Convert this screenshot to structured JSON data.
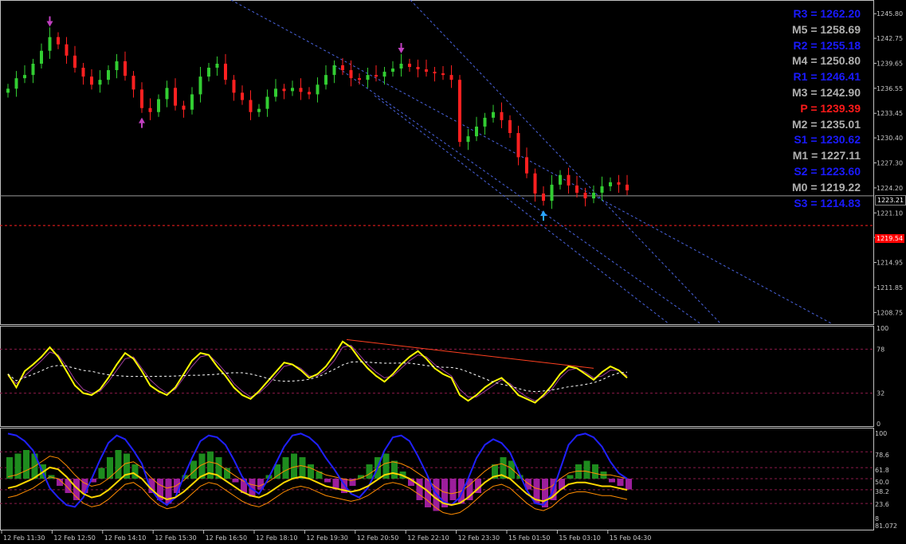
{
  "price_axis": {
    "labels": [
      "1245.80",
      "1242.75",
      "1239.65",
      "1236.55",
      "1233.45",
      "1230.40",
      "1227.30",
      "1224.20",
      "1221.10",
      "1218.05",
      "1214.95",
      "1211.85",
      "1208.75"
    ],
    "current_price": "1223.21",
    "alert_price": "1219.54"
  },
  "stoch_axis": {
    "labels": [
      "100",
      "78",
      "32",
      "0"
    ]
  },
  "osc_axis": {
    "labels": [
      "100",
      "78.6",
      "61.8",
      "50.0",
      "38.2",
      "23.6",
      "8",
      "81.072"
    ]
  },
  "time_axis": {
    "labels": [
      "12 Feb 11:30",
      "12 Feb 12:50",
      "12 Feb 14:10",
      "12 Feb 15:30",
      "12 Feb 16:50",
      "12 Feb 18:10",
      "12 Feb 19:30",
      "12 Feb 20:50",
      "12 Feb 22:10",
      "12 Feb 23:30",
      "15 Feb 01:50",
      "15 Feb 03:10",
      "15 Feb 04:30"
    ]
  },
  "pivots": [
    {
      "label": "R3 = 1262.20",
      "color": "#1a1aff"
    },
    {
      "label": "M5 = 1258.69",
      "color": "#b0b0b0"
    },
    {
      "label": "R2 = 1255.18",
      "color": "#1a1aff"
    },
    {
      "label": "M4 = 1250.80",
      "color": "#b0b0b0"
    },
    {
      "label": "R1 = 1246.41",
      "color": "#1a1aff"
    },
    {
      "label": "M3 = 1242.90",
      "color": "#b0b0b0"
    },
    {
      "label": "P  = 1239.39",
      "color": "#ff1a1a"
    },
    {
      "label": "M2 = 1235.01",
      "color": "#b0b0b0"
    },
    {
      "label": "S1 = 1230.62",
      "color": "#1a1aff"
    },
    {
      "label": "M1 = 1227.11",
      "color": "#b0b0b0"
    },
    {
      "label": "S2 = 1223.60",
      "color": "#1a1aff"
    },
    {
      "label": "M0 = 1219.22",
      "color": "#b0b0b0"
    },
    {
      "label": "S3 = 1214.83",
      "color": "#1a1aff"
    }
  ],
  "colors": {
    "bull": "#32cd32",
    "bear": "#ff2020",
    "channel": "#4a64e0",
    "stoch_main": "#ffff00",
    "stoch_signal": "#9a3a9a",
    "stoch_ma": "#ffffff",
    "osc_blue": "#2020ff",
    "osc_yellow": "#ffd700",
    "osc_orange": "#ff8c00",
    "hist_pos": "#1e8c1e",
    "hist_neg": "#9c1e9c",
    "level_dash": "#8c1a4a"
  },
  "chart_data": {
    "type": "candlestick",
    "ylim": [
      1207.4,
      1247.3
    ],
    "close_path": [
      1236.5,
      1237.8,
      1238.2,
      1239.6,
      1241.2,
      1242.9,
      1242.0,
      1240.6,
      1239.1,
      1238.0,
      1237.0,
      1237.6,
      1238.8,
      1239.9,
      1238.1,
      1236.4,
      1234.1,
      1233.6,
      1235.2,
      1236.6,
      1234.4,
      1233.9,
      1235.8,
      1238.0,
      1239.1,
      1239.6,
      1237.6,
      1236.0,
      1235.1,
      1233.6,
      1234.0,
      1235.5,
      1236.5,
      1236.2,
      1236.6,
      1236.1,
      1235.8,
      1237.0,
      1238.2,
      1239.4,
      1238.8,
      1237.8,
      1237.6,
      1238.2,
      1238.0,
      1238.6,
      1239.0,
      1239.6,
      1239.2,
      1238.9,
      1238.6,
      1238.4,
      1238.2,
      1237.6,
      1229.9,
      1230.6,
      1231.8,
      1232.9,
      1233.6,
      1232.6,
      1231.0,
      1228.0,
      1226.0,
      1223.5,
      1222.6,
      1224.6,
      1225.8,
      1224.5,
      1223.6,
      1222.9,
      1223.6,
      1224.4,
      1224.9,
      1224.6,
      1223.9
    ],
    "markers": [
      {
        "type": "down-arrow",
        "at_index": 5
      },
      {
        "type": "up-arrow",
        "at_index": 16
      },
      {
        "type": "down-arrow",
        "at_index": 47
      },
      {
        "type": "up-arrow",
        "at_index": 64
      }
    ],
    "stochastic": {
      "levels": [
        78,
        32
      ],
      "main": [
        52,
        38,
        55,
        62,
        70,
        80,
        70,
        55,
        40,
        32,
        30,
        36,
        48,
        62,
        74,
        68,
        55,
        40,
        34,
        30,
        38,
        52,
        66,
        74,
        72,
        60,
        50,
        38,
        30,
        26,
        34,
        44,
        54,
        64,
        62,
        56,
        48,
        52,
        60,
        72,
        86,
        80,
        68,
        58,
        50,
        44,
        52,
        62,
        70,
        76,
        68,
        58,
        52,
        48,
        30,
        24,
        30,
        38,
        44,
        48,
        40,
        30,
        26,
        22,
        30,
        40,
        52,
        60,
        58,
        52,
        46,
        54,
        60,
        56,
        48
      ],
      "signal": [
        50,
        42,
        50,
        58,
        66,
        75,
        72,
        60,
        46,
        36,
        32,
        34,
        44,
        56,
        68,
        70,
        58,
        46,
        38,
        32,
        36,
        48,
        60,
        70,
        72,
        64,
        54,
        42,
        34,
        28,
        32,
        40,
        50,
        60,
        62,
        58,
        50,
        50,
        56,
        66,
        80,
        82,
        72,
        62,
        54,
        48,
        50,
        58,
        66,
        72,
        70,
        62,
        56,
        50,
        36,
        28,
        28,
        34,
        40,
        46,
        42,
        34,
        28,
        24,
        28,
        36,
        48,
        56,
        58,
        54,
        48,
        50,
        56,
        56,
        50
      ]
    },
    "oscillator": {
      "levels": [
        78.6,
        61.8,
        50.0,
        38.2,
        23.6
      ],
      "blue": [
        98,
        96,
        90,
        80,
        60,
        40,
        30,
        22,
        20,
        30,
        50,
        70,
        88,
        96,
        92,
        80,
        66,
        40,
        28,
        22,
        30,
        52,
        72,
        90,
        96,
        94,
        86,
        70,
        52,
        40,
        34,
        48,
        66,
        84,
        96,
        98,
        94,
        86,
        72,
        60,
        46,
        34,
        30,
        40,
        58,
        80,
        94,
        96,
        90,
        74,
        56,
        36,
        26,
        22,
        30,
        50,
        72,
        86,
        92,
        88,
        78,
        58,
        38,
        24,
        22,
        34,
        60,
        86,
        96,
        98,
        94,
        84,
        68,
        56,
        50
      ],
      "yellow": [
        40,
        42,
        46,
        50,
        56,
        62,
        60,
        52,
        42,
        34,
        30,
        32,
        38,
        46,
        54,
        56,
        50,
        40,
        32,
        28,
        30,
        36,
        44,
        52,
        56,
        54,
        48,
        42,
        36,
        32,
        30,
        34,
        40,
        46,
        50,
        52,
        50,
        46,
        42,
        40,
        38,
        36,
        38,
        42,
        48,
        54,
        56,
        54,
        50,
        44,
        38,
        30,
        24,
        22,
        24,
        30,
        38,
        46,
        52,
        54,
        50,
        42,
        34,
        28,
        26,
        30,
        38,
        44,
        46,
        46,
        44,
        42,
        42,
        40,
        38
      ],
      "hist": [
        60,
        70,
        80,
        70,
        40,
        10,
        -20,
        -40,
        -60,
        -40,
        -10,
        30,
        60,
        80,
        70,
        40,
        0,
        -40,
        -60,
        -70,
        -40,
        10,
        50,
        70,
        76,
        60,
        30,
        -10,
        -40,
        -50,
        -30,
        10,
        40,
        60,
        70,
        60,
        40,
        20,
        -10,
        -30,
        -40,
        -20,
        10,
        40,
        60,
        70,
        50,
        20,
        -20,
        -60,
        -80,
        -90,
        -80,
        -60,
        -70,
        -60,
        -40,
        0,
        40,
        60,
        50,
        10,
        -30,
        -70,
        -80,
        -60,
        -30,
        10,
        40,
        50,
        40,
        20,
        -10,
        -20,
        -30
      ]
    }
  }
}
